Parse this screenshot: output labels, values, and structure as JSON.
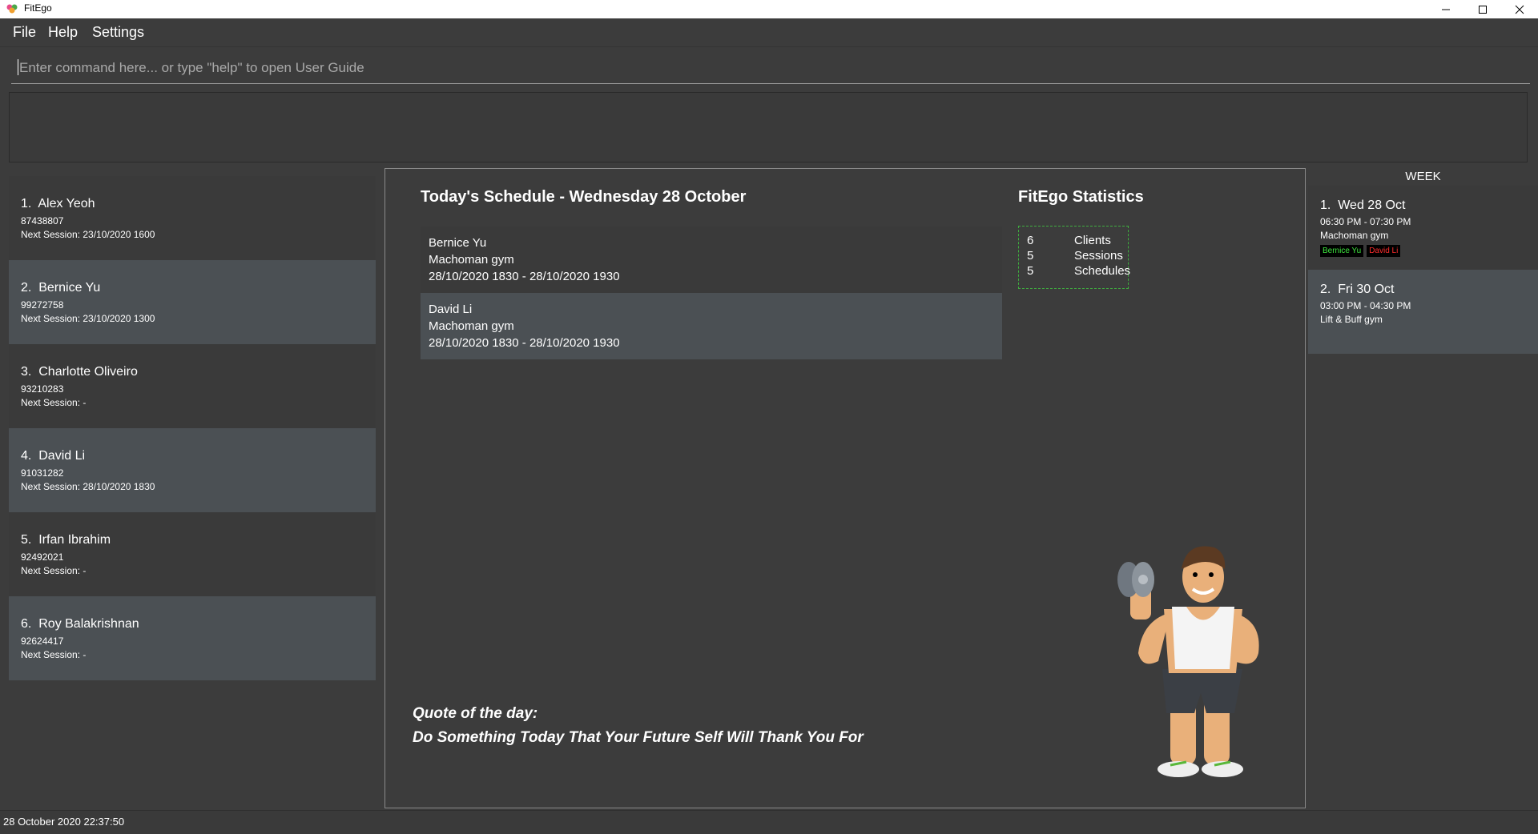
{
  "window": {
    "title": "FitEgo"
  },
  "menu": {
    "file": "File",
    "help": "Help",
    "settings": "Settings"
  },
  "command": {
    "placeholder": "Enter command here... or type \"help\" to open User Guide",
    "value": ""
  },
  "clients": [
    {
      "index": "1.",
      "name": "Alex Yeoh",
      "phone": "87438807",
      "next_session": "Next Session: 23/10/2020 1600"
    },
    {
      "index": "2.",
      "name": "Bernice Yu",
      "phone": "99272758",
      "next_session": "Next Session: 23/10/2020 1300"
    },
    {
      "index": "3.",
      "name": "Charlotte Oliveiro",
      "phone": "93210283",
      "next_session": "Next Session:  -"
    },
    {
      "index": "4.",
      "name": "David Li",
      "phone": "91031282",
      "next_session": "Next Session: 28/10/2020 1830"
    },
    {
      "index": "5.",
      "name": "Irfan Ibrahim",
      "phone": "92492021",
      "next_session": "Next Session:  -"
    },
    {
      "index": "6.",
      "name": "Roy Balakrishnan",
      "phone": "92624417",
      "next_session": "Next Session:  -"
    }
  ],
  "schedule": {
    "title": "Today's Schedule - Wednesday 28 October",
    "items": [
      {
        "client": "Bernice Yu",
        "gym": "Machoman gym",
        "time": "28/10/2020 1830 - 28/10/2020 1930"
      },
      {
        "client": "David Li",
        "gym": "Machoman gym",
        "time": "28/10/2020 1830 - 28/10/2020 1930"
      }
    ]
  },
  "stats": {
    "title": "FitEgo Statistics",
    "rows": [
      {
        "value": "6",
        "label": "Clients"
      },
      {
        "value": "5",
        "label": "Sessions"
      },
      {
        "value": "5",
        "label": "Schedules"
      }
    ],
    "border_color": "#3fae3f"
  },
  "quote": {
    "label": "Quote of the day:",
    "text": "Do Something Today That Your Future Self Will Thank You For"
  },
  "week": {
    "header": "WEEK",
    "items": [
      {
        "index": "1.",
        "day": "Wed 28 Oct",
        "time": "06:30 PM - 07:30 PM",
        "gym": "Machoman gym",
        "tags": [
          {
            "name": "Bernice Yu",
            "color": "#3ee83e"
          },
          {
            "name": "David Li",
            "color": "#ff2d2d"
          }
        ]
      },
      {
        "index": "2.",
        "day": "Fri 30 Oct",
        "time": "03:00 PM - 04:30 PM",
        "gym": "Lift & Buff gym",
        "tags": []
      }
    ]
  },
  "status": {
    "datetime": "28 October 2020 22:37:50"
  },
  "colors": {
    "background": "#3c3c3c",
    "card_alt": "#4b5054",
    "titlebar": "#ffffff"
  }
}
